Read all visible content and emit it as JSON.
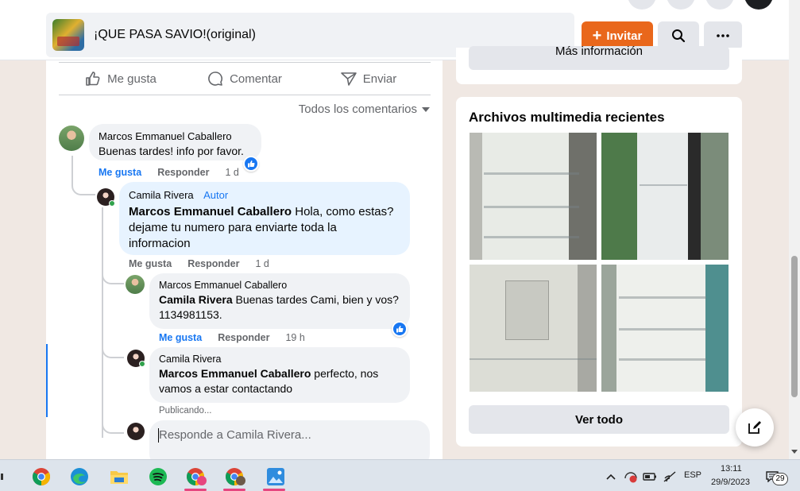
{
  "group": {
    "name": "¡QUE PASA SAVIO!(original)",
    "invite_label": "Invitar"
  },
  "post_actions": {
    "like": "Me gusta",
    "comment": "Comentar",
    "share": "Enviar"
  },
  "comments_filter": "Todos los comentarios",
  "comments": [
    {
      "author": "Marcos Emmanuel Caballero",
      "text": "Buenas tardes! info por favor.",
      "like_label": "Me gusta",
      "reply_label": "Responder",
      "time": "1 d"
    },
    {
      "author": "Camila Rivera",
      "badge": "Autor",
      "mention": "Marcos Emmanuel Caballero",
      "text": " Hola, como estas? dejame tu numero para enviarte toda la informacion",
      "like_label": "Me gusta",
      "reply_label": "Responder",
      "time": "1 d"
    },
    {
      "author": "Marcos Emmanuel Caballero",
      "mention": "Camila Rivera",
      "text": " Buenas tardes Cami, bien y vos?1134981153.",
      "like_label": "Me gusta",
      "reply_label": "Responder",
      "time": "19 h"
    },
    {
      "author": "Camila Rivera",
      "mention": "Marcos Emmanuel Caballero",
      "text": " perfecto, nos vamos a estar contactando",
      "status": "Publicando..."
    }
  ],
  "reply_input": {
    "placeholder": "Responde a Camila Rivera..."
  },
  "sidebar": {
    "more_info_label": "Más información",
    "media_title": "Archivos multimedia recientes",
    "see_all_label": "Ver todo"
  },
  "taskbar": {
    "language": "ESP",
    "time": "13:11",
    "date": "29/9/2023",
    "notifications": "29"
  },
  "colors": {
    "accent": "#1877f2",
    "invite": "#e9671b",
    "background": "#f0e8e3"
  }
}
